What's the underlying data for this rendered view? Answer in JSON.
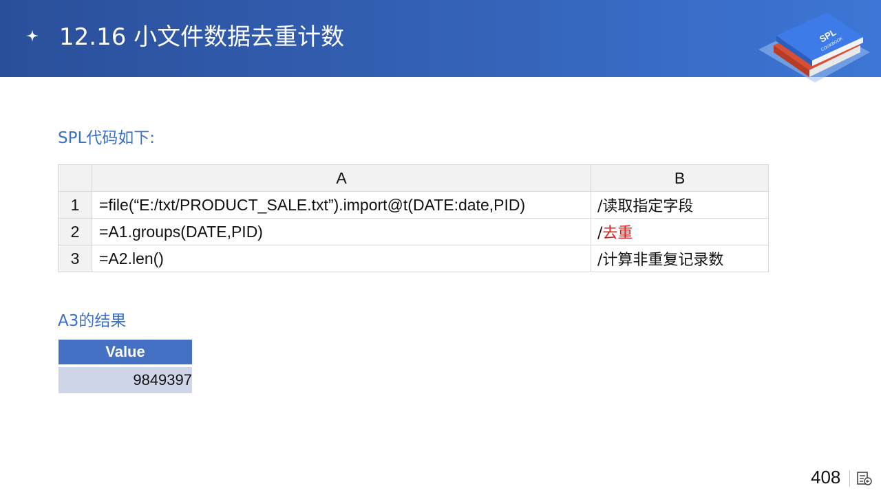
{
  "header": {
    "title": "12.16 小文件数据去重计数",
    "bullet_icon": "four-point-star-icon",
    "logo_icon": "spl-cookbook-books-icon",
    "logo_text_main": "SPL",
    "logo_text_sub": "COOKBOOK",
    "background_colors": [
      "#2a4f9a",
      "#3d76d6"
    ]
  },
  "code_section": {
    "label": "SPL代码如下:",
    "column_headers": [
      "A",
      "B"
    ],
    "rows": [
      {
        "num": "1",
        "code": "=file(“E:/txt/PRODUCT_SALE.txt”).import@t(DATE:date,PID)",
        "comment_prefix": "/",
        "comment": "读取指定字段"
      },
      {
        "num": "2",
        "code": "=A1.groups(DATE,PID)",
        "comment_prefix": "/",
        "comment": "去重"
      },
      {
        "num": "3",
        "code": "=A2.len()",
        "comment_prefix": "/",
        "comment": "计算非重复记录数"
      }
    ],
    "highlight_color": "#e21b1b"
  },
  "result_section": {
    "label": "A3的结果",
    "table": {
      "header": "Value",
      "value": "9849397"
    }
  },
  "footer": {
    "page_number": "408",
    "nav_icon": "slide-navigation-icon"
  },
  "colors": {
    "accent": "#3b6fc7",
    "table_header": "#4471c4",
    "table_cell": "#d0d6ea"
  }
}
